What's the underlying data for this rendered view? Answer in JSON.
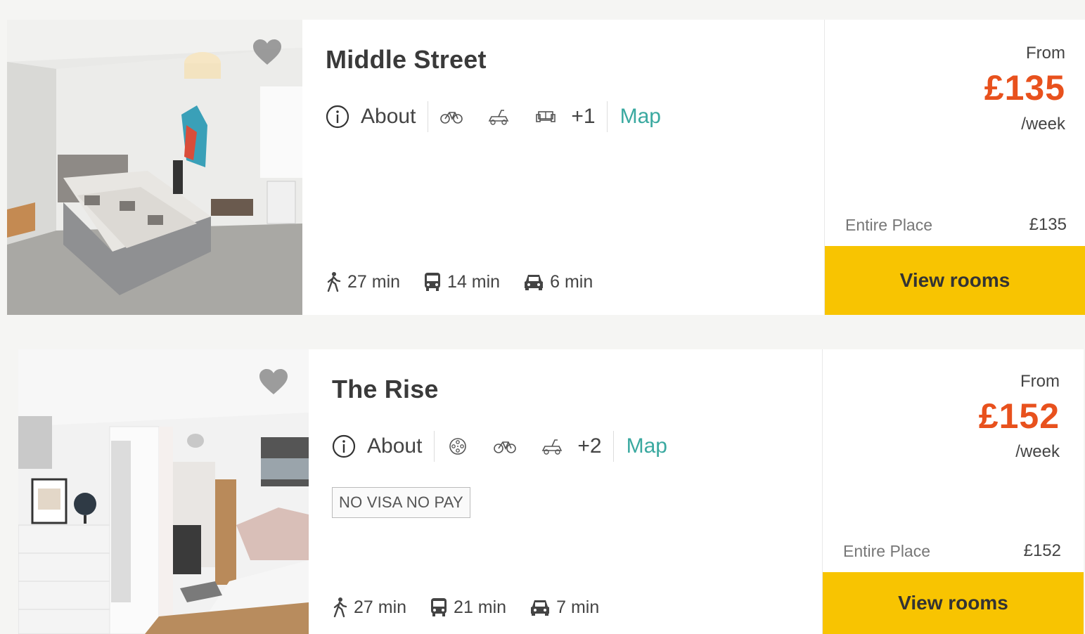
{
  "listings": [
    {
      "title": "Middle Street",
      "about_label": "About",
      "feature_icons": [
        "bicycle-icon",
        "tricycle-icon",
        "sofa-icon"
      ],
      "more_features": "+1",
      "map_label": "Map",
      "badge": "",
      "travel": [
        {
          "icon": "walk-icon",
          "text": "27 min"
        },
        {
          "icon": "bus-icon",
          "text": "14 min"
        },
        {
          "icon": "car-icon",
          "text": "6 min"
        }
      ],
      "from_label": "From",
      "price": "£135",
      "per_label": "/week",
      "room_type": "Entire Place",
      "room_price": "£135",
      "cta_label": "View rooms"
    },
    {
      "title": "The Rise",
      "about_label": "About",
      "feature_icons": [
        "film-reel-icon",
        "bicycle-icon",
        "tricycle-icon"
      ],
      "more_features": "+2",
      "map_label": "Map",
      "badge": "NO VISA NO PAY",
      "travel": [
        {
          "icon": "walk-icon",
          "text": "27 min"
        },
        {
          "icon": "bus-icon",
          "text": "21 min"
        },
        {
          "icon": "car-icon",
          "text": "7 min"
        }
      ],
      "from_label": "From",
      "price": "£152",
      "per_label": "/week",
      "room_type": "Entire Place",
      "room_price": "£152",
      "cta_label": "View rooms"
    }
  ],
  "colors": {
    "price": "#e8511d",
    "cta": "#f8c401",
    "map_link": "#3aa9a0"
  }
}
